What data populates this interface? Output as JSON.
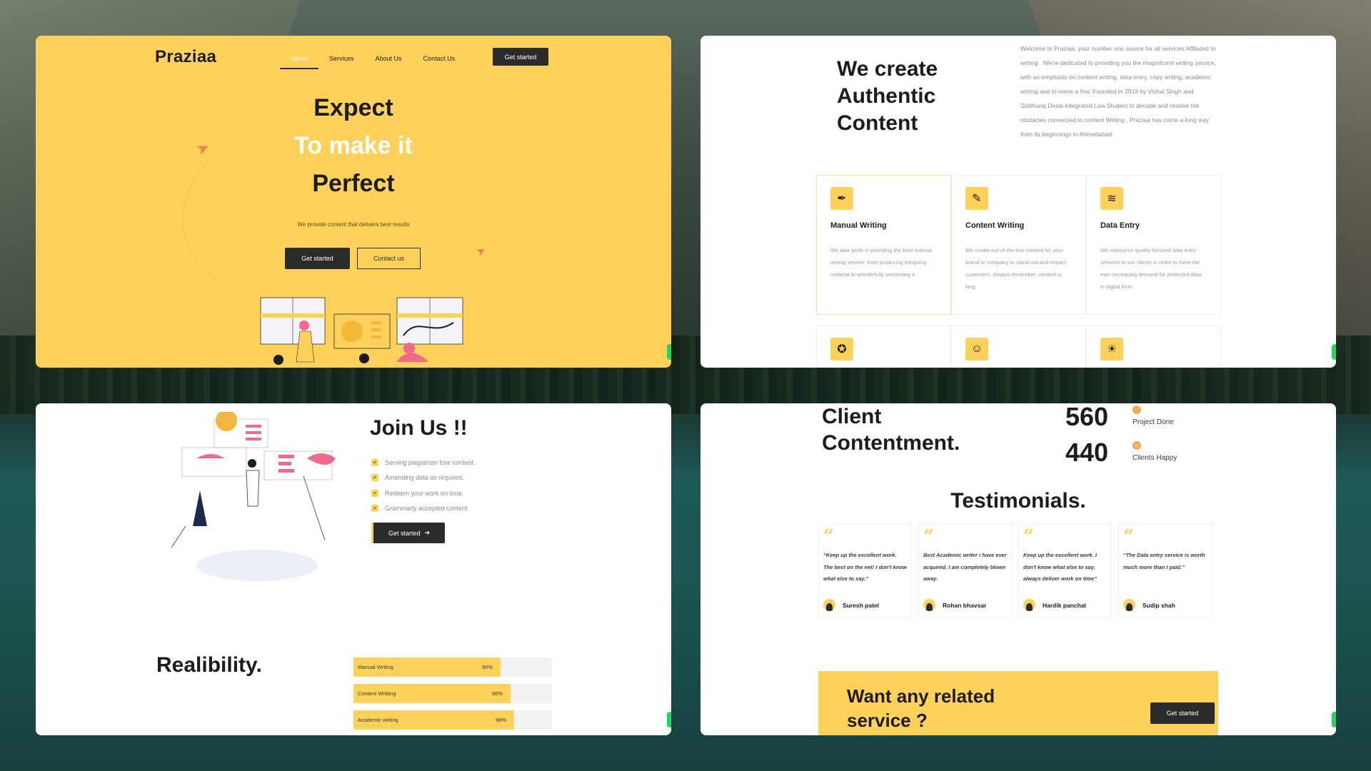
{
  "colors": {
    "accent": "#fdd15a",
    "dark": "#2b2b2b",
    "whatsapp": "#25d366"
  },
  "hero": {
    "logo": "Praziaa",
    "nav": [
      "Home",
      "Services",
      "About Us",
      "Contact Us"
    ],
    "cta_top": "Get started",
    "line1": "Expect",
    "line2": "To make it",
    "line3": "Perfect",
    "subtitle": "We provide content that delivers best results",
    "btn_primary": "Get started",
    "btn_secondary": "Contact us"
  },
  "about": {
    "title_line1": "We create",
    "title_line2": "Authentic",
    "title_line3": "Content",
    "intro": "Welcome to Praziaa, your number one source for all services Affiliated to writing . We're dedicated to providing you the magnificent writing service, with an emphasis on content writing, data entry, copy writing, academic writing and to name a few. Founded in 2019 by Vishal Singh and Siddharaj Desai Integrated Law Student to decode and resolve the obstacles connected to content Writing , Praziaa has come a long way from its beginnings in Ahmedabad.",
    "services": [
      {
        "title": "Manual Writing",
        "icon": "pen-nib-icon",
        "glyph": "✒",
        "desc": "We take pride in providing the best manual writing service, from producing intriguing material to wonderfully presenting it."
      },
      {
        "title": "Content Writing",
        "icon": "pencil-ruler-icon",
        "glyph": "✎",
        "desc": "We create out-of-the-box content for your brand or company to stand out and impact customers. Always remember, content is king"
      },
      {
        "title": "Data Entry",
        "icon": "layers-icon",
        "glyph": "≋",
        "desc": "We outsource quality-focused data entry services to our clients in order to meet the ever-increasing demand for protected data in digital form."
      }
    ],
    "services_row2_icons": [
      {
        "icon": "award-icon",
        "glyph": "✪"
      },
      {
        "icon": "user-circle-icon",
        "glyph": "☺"
      },
      {
        "icon": "lightbulb-icon",
        "glyph": "☀"
      }
    ]
  },
  "join": {
    "title": "Join Us !!",
    "items": [
      "Serving plagiarism free content.",
      "Amending data as required.",
      "Redeem your work on time.",
      "Grammarly accepted content."
    ],
    "cta": "Get started",
    "cta_arrow": "➔",
    "realibility_title": "Realibility.",
    "bars": [
      {
        "label": "Manual Writing",
        "value_text": "90%",
        "value": 0.74
      },
      {
        "label": "Content Writting",
        "value_text": "96%",
        "value": 0.79
      },
      {
        "label": "Academic writing",
        "value_text": "98%",
        "value": 0.81
      }
    ]
  },
  "stats": {
    "title_line1": "Client",
    "title_line2": "Contentment.",
    "items": [
      {
        "num": "560",
        "label": "Project Done",
        "icon": "check-circle-icon"
      },
      {
        "num": "440",
        "label": "Clients Happy",
        "icon": "smile-icon"
      }
    ],
    "testimonials_title": "Testimonials.",
    "testimonials": [
      {
        "text": "“Keep up the excellent work. The best on the net! I don't know what else to say.”",
        "author": "Suresh patel"
      },
      {
        "text": "Best Academic writer i have ever acquired. I am completely blown away.",
        "author": "Rohan bhavsar"
      },
      {
        "text": "Keep up the excellent work. I don't know what else to say. always deliver work on time”",
        "author": "Hardik panchal"
      },
      {
        "text": "“The Data entry service is worth much more than I paid.”",
        "author": "Sudip shah"
      }
    ],
    "quote_glyph": "“",
    "cta_line1": "Want any related",
    "cta_line2": "service ?",
    "cta_button": "Get started"
  }
}
